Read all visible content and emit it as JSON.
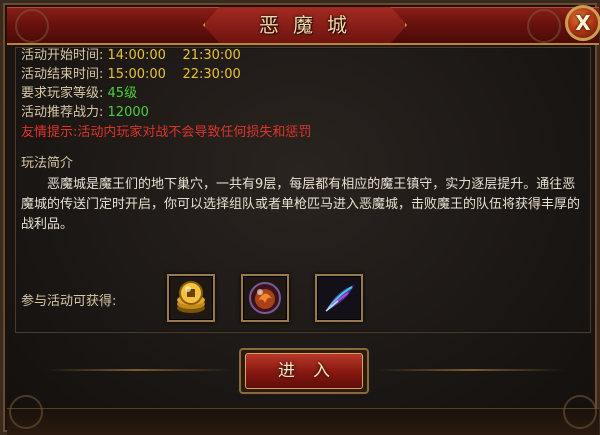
{
  "window": {
    "title": "恶魔城",
    "close_label": "X"
  },
  "info": {
    "start_label": "活动开始时间:",
    "start_times": "14:00:00    21:30:00",
    "end_label": "活动结束时间:",
    "end_times": "15:00:00    22:30:00",
    "level_label": "要求玩家等级:",
    "level_value": "45级",
    "power_label": "活动推荐战力:",
    "power_value": "12000",
    "warning": "友情提示:活动内玩家对战不会导致任何损失和惩罚"
  },
  "gameplay": {
    "title": "玩法简介",
    "description": "恶魔城是魔王们的地下巢穴，一共有9层，每层都有相应的魔王镇守，实力逐层提升。通往恶魔城的传送门定时开启，你可以选择组队或者单枪匹马进入恶魔城，击败魔王的队伍将获得丰厚的战利品。"
  },
  "rewards": {
    "label": "参与活动可获得:",
    "items": [
      {
        "icon": "gold-coins-icon"
      },
      {
        "icon": "fire-orb-icon"
      },
      {
        "icon": "feather-icon"
      }
    ]
  },
  "actions": {
    "enter_label": "进入"
  },
  "colors": {
    "title_red": "#6a120e",
    "label": "#d7c7a6",
    "time_yellow": "#e9c237",
    "value_green": "#49d13c",
    "warning_red": "#e0332a",
    "gold_border": "#9a7a4a"
  }
}
